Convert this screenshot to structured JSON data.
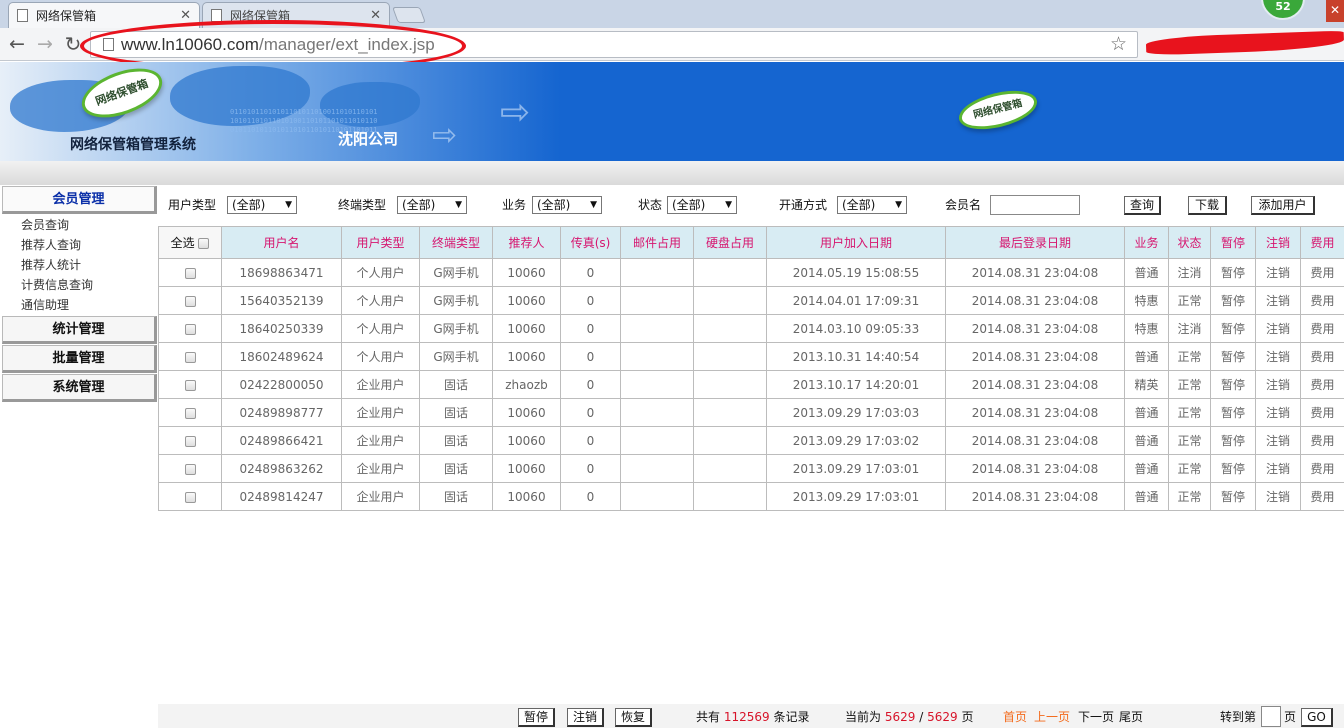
{
  "browser": {
    "tabs": [
      {
        "title": "网络保管箱",
        "active": true
      },
      {
        "title": "网络保管箱",
        "active": false
      }
    ],
    "url_host": "www.ln10060.com",
    "url_path": "/manager/ext_index.jsp",
    "notification_count": "52"
  },
  "banner": {
    "logo_text": "网络保管箱",
    "system_title": "网络保管箱管理系统",
    "company": "沈阳公司"
  },
  "sidebar": {
    "sections": [
      {
        "label": "会员管理",
        "items": [
          "会员查询",
          "推荐人查询",
          "推荐人统计",
          "计费信息查询",
          "通信助理"
        ]
      },
      {
        "label": "统计管理"
      },
      {
        "label": "批量管理"
      },
      {
        "label": "系统管理"
      }
    ]
  },
  "filters": {
    "user_type_label": "用户类型",
    "terminal_type_label": "终端类型",
    "business_label": "业务",
    "status_label": "状态",
    "open_method_label": "开通方式",
    "all_option": "(全部)",
    "member_name_label": "会员名",
    "member_name_value": "",
    "query_button": "查询",
    "download_button": "下载",
    "add_user_button": "添加用户"
  },
  "table": {
    "select_all": "全选",
    "headers": [
      "用户名",
      "用户类型",
      "终端类型",
      "推荐人",
      "传真(s)",
      "邮件占用",
      "硬盘占用",
      "用户加入日期",
      "最后登录日期",
      "业务",
      "状态",
      "暂停",
      "注销",
      "费用"
    ],
    "rows": [
      {
        "user": "18698863471",
        "type": "个人用户",
        "terminal": "G网手机",
        "referrer": "10060",
        "fax": "0",
        "mail": "",
        "disk": "",
        "joined": "2014.05.19 15:08:55",
        "last_login": "2014.08.31 23:04:08",
        "business": "普通",
        "status": "注消",
        "pause": "暂停",
        "cancel": "注销",
        "fee": "费用"
      },
      {
        "user": "15640352139",
        "type": "个人用户",
        "terminal": "G网手机",
        "referrer": "10060",
        "fax": "0",
        "mail": "",
        "disk": "",
        "joined": "2014.04.01 17:09:31",
        "last_login": "2014.08.31 23:04:08",
        "business": "特惠",
        "status": "正常",
        "pause": "暂停",
        "cancel": "注销",
        "fee": "费用"
      },
      {
        "user": "18640250339",
        "type": "个人用户",
        "terminal": "G网手机",
        "referrer": "10060",
        "fax": "0",
        "mail": "",
        "disk": "",
        "joined": "2014.03.10 09:05:33",
        "last_login": "2014.08.31 23:04:08",
        "business": "特惠",
        "status": "注消",
        "pause": "暂停",
        "cancel": "注销",
        "fee": "费用"
      },
      {
        "user": "18602489624",
        "type": "个人用户",
        "terminal": "G网手机",
        "referrer": "10060",
        "fax": "0",
        "mail": "",
        "disk": "",
        "joined": "2013.10.31 14:40:54",
        "last_login": "2014.08.31 23:04:08",
        "business": "普通",
        "status": "正常",
        "pause": "暂停",
        "cancel": "注销",
        "fee": "费用"
      },
      {
        "user": "02422800050",
        "type": "企业用户",
        "terminal": "固话",
        "referrer": "zhaozb",
        "fax": "0",
        "mail": "",
        "disk": "",
        "joined": "2013.10.17 14:20:01",
        "last_login": "2014.08.31 23:04:08",
        "business": "精英",
        "status": "正常",
        "pause": "暂停",
        "cancel": "注销",
        "fee": "费用"
      },
      {
        "user": "02489898777",
        "type": "企业用户",
        "terminal": "固话",
        "referrer": "10060",
        "fax": "0",
        "mail": "",
        "disk": "",
        "joined": "2013.09.29 17:03:03",
        "last_login": "2014.08.31 23:04:08",
        "business": "普通",
        "status": "正常",
        "pause": "暂停",
        "cancel": "注销",
        "fee": "费用"
      },
      {
        "user": "02489866421",
        "type": "企业用户",
        "terminal": "固话",
        "referrer": "10060",
        "fax": "0",
        "mail": "",
        "disk": "",
        "joined": "2013.09.29 17:03:02",
        "last_login": "2014.08.31 23:04:08",
        "business": "普通",
        "status": "正常",
        "pause": "暂停",
        "cancel": "注销",
        "fee": "费用"
      },
      {
        "user": "02489863262",
        "type": "企业用户",
        "terminal": "固话",
        "referrer": "10060",
        "fax": "0",
        "mail": "",
        "disk": "",
        "joined": "2013.09.29 17:03:01",
        "last_login": "2014.08.31 23:04:08",
        "business": "普通",
        "status": "正常",
        "pause": "暂停",
        "cancel": "注销",
        "fee": "费用"
      },
      {
        "user": "02489814247",
        "type": "企业用户",
        "terminal": "固话",
        "referrer": "10060",
        "fax": "0",
        "mail": "",
        "disk": "",
        "joined": "2013.09.29 17:03:01",
        "last_login": "2014.08.31 23:04:08",
        "business": "普通",
        "status": "正常",
        "pause": "暂停",
        "cancel": "注销",
        "fee": "费用"
      }
    ]
  },
  "footer": {
    "pause_button": "暂停",
    "cancel_button": "注销",
    "restore_button": "恢复",
    "total_prefix": "共有",
    "total_count": "112569",
    "total_suffix": "条记录",
    "current_prefix": "当前为",
    "current_page": "5629",
    "page_sep": "/",
    "total_pages": "5629",
    "page_unit": "页",
    "first_page": "首页",
    "prev_page": "上一页",
    "next_page": "下一页",
    "last_page": "尾页",
    "goto_label": "转到第",
    "goto_unit": "页",
    "go_button": "GO"
  }
}
